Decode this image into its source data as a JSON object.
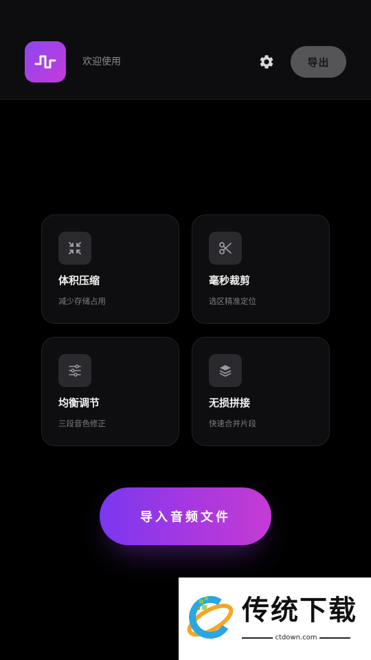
{
  "header": {
    "welcome": "欢迎使用",
    "export_label": "导出"
  },
  "features": [
    {
      "title": "体积压缩",
      "subtitle": "减少存储占用",
      "icon": "compress-icon"
    },
    {
      "title": "毫秒裁剪",
      "subtitle": "选区精准定位",
      "icon": "scissors-icon"
    },
    {
      "title": "均衡调节",
      "subtitle": "三段音色修正",
      "icon": "sliders-icon"
    },
    {
      "title": "无损拼接",
      "subtitle": "快速合并片段",
      "icon": "layers-icon"
    }
  ],
  "import_label": "导入音频文件",
  "watermark": {
    "brand": "传统下载",
    "url": "ctdown.com"
  },
  "colors": {
    "accent_start": "#7a37f0",
    "accent_end": "#c53bd4",
    "background": "#000000"
  }
}
